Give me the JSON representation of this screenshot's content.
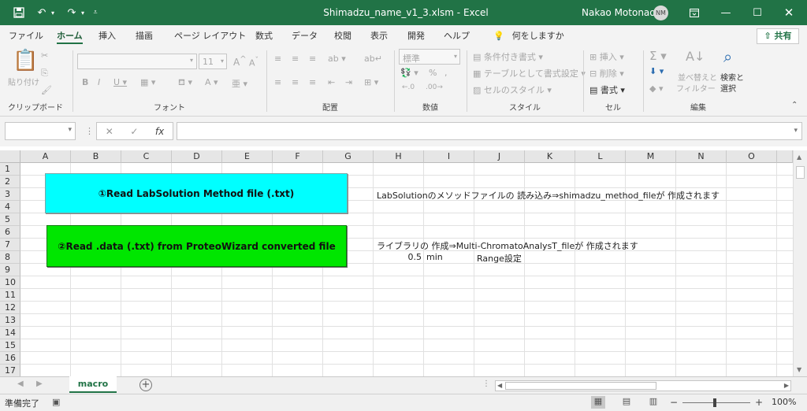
{
  "titlebar": {
    "save_icon": "save-icon",
    "undo_icon": "undo-icon",
    "redo_icon": "redo-icon",
    "title": "Shimadzu_name_v1_3.xlsm  -  Excel",
    "user": "Nakao Motonao",
    "avatar": "NM",
    "color": "#217346"
  },
  "tabs": [
    "ファイル",
    "ホーム",
    "挿入",
    "描画",
    "ページ レイアウト",
    "数式",
    "データ",
    "校閲",
    "表示",
    "開発",
    "ヘルプ"
  ],
  "tell_me": "何をしますか",
  "share": "共有",
  "ribbon": {
    "clipboard": {
      "paste": "貼り付け",
      "label": "クリップボード"
    },
    "font": {
      "size": "11",
      "label": "フォント"
    },
    "align": {
      "label": "配置"
    },
    "number": {
      "format": "標準",
      "label": "数値"
    },
    "styles": {
      "cond": "条件付き書式",
      "table": "テーブルとして書式設定",
      "cell": "セルのスタイル",
      "label": "スタイル"
    },
    "cells": {
      "insert": "挿入",
      "delete": "削除",
      "format": "書式",
      "label": "セル"
    },
    "editing": {
      "sort": "並べ替えと",
      "sort2": "フィルター",
      "find": "検索と",
      "find2": "選択",
      "label": "編集"
    }
  },
  "formula": {
    "fx": "fx"
  },
  "columns": [
    "A",
    "B",
    "C",
    "D",
    "E",
    "F",
    "G",
    "H",
    "I",
    "J",
    "K",
    "L",
    "M",
    "N",
    "O"
  ],
  "rows": [
    "1",
    "2",
    "3",
    "4",
    "5",
    "6",
    "7",
    "8",
    "9",
    "10",
    "11",
    "12",
    "13",
    "14",
    "15",
    "16",
    "17"
  ],
  "cells": {
    "h3": "LabSolutionのメソッドファイルの 読み込み⇒shimadzu_method_fileが 作成されます",
    "h7": "ライブラリの 作成⇒Multi-ChromatoAnalysT_fileが 作成されます",
    "h8": "0.5",
    "i8": "min",
    "j8": "Range設定"
  },
  "buttons": {
    "read_method": "①Read LabSolution Method file (.txt)",
    "read_data": "②Read .data (.txt) from ProteoWizard converted file",
    "method_color": "#00ffff",
    "data_color": "#00e600"
  },
  "sheet": {
    "name": "macro"
  },
  "status": {
    "ready": "準備完了",
    "zoom": "100%"
  }
}
